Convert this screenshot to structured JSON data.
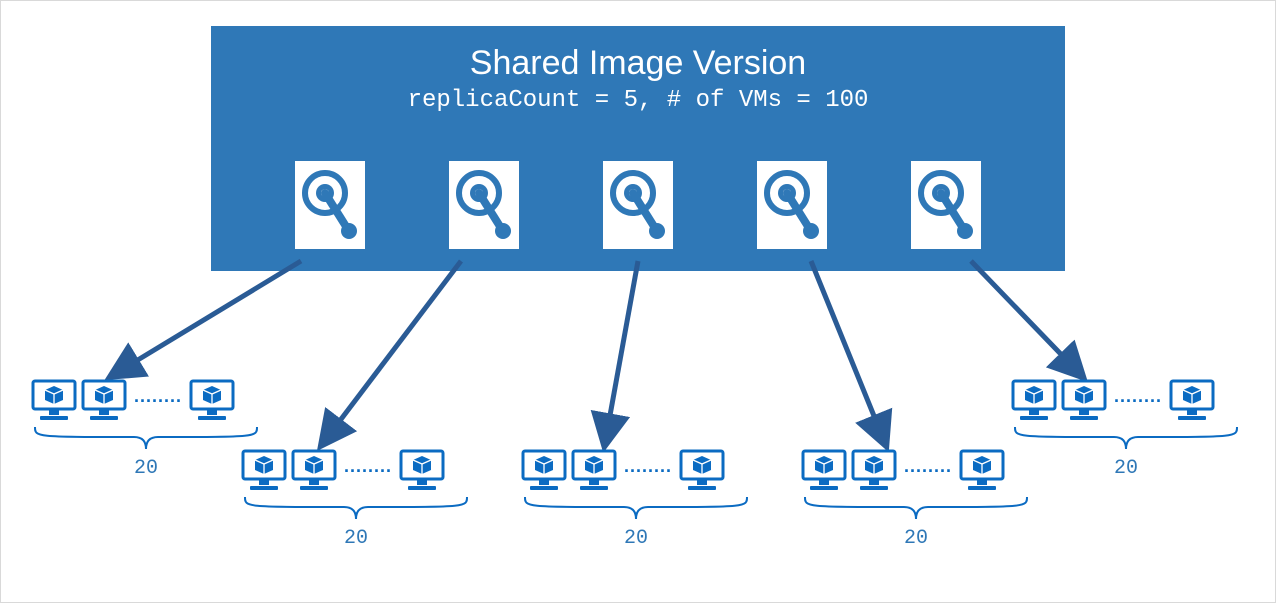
{
  "header": {
    "title": "Shared Image Version",
    "subtitle": "replicaCount = 5, # of VMs = 100"
  },
  "replicas": {
    "count": 5
  },
  "clusters": [
    {
      "label": "20"
    },
    {
      "label": "20"
    },
    {
      "label": "20"
    },
    {
      "label": "20"
    },
    {
      "label": "20"
    }
  ],
  "colors": {
    "primary": "#2f78b7",
    "accent": "#0b6bc2",
    "arrow": "#2a5b95"
  }
}
